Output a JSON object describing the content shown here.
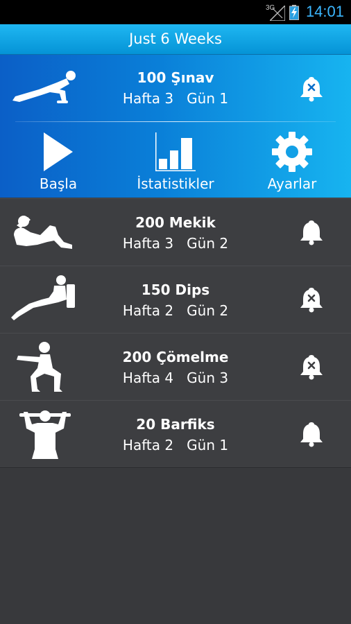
{
  "status_bar": {
    "network": "3G",
    "time": "14:01",
    "icons": [
      "signal-icon",
      "battery-charging-icon"
    ]
  },
  "header": {
    "title": "Just 6 Weeks"
  },
  "featured": {
    "name": "100 Şınav",
    "subtitle": "Hafta 3   Gün 1",
    "icon": "pushup-figure-icon",
    "reminder_icon": "bell-off-icon",
    "actions": [
      {
        "label": "Başla",
        "icon": "play-icon"
      },
      {
        "label": "İstatistikler",
        "icon": "bar-chart-icon"
      },
      {
        "label": "Ayarlar",
        "icon": "gear-icon"
      }
    ]
  },
  "exercises": [
    {
      "name": "200 Mekik",
      "subtitle": "Hafta 3   Gün 2",
      "icon": "situp-figure-icon",
      "reminder_icon": "bell-icon"
    },
    {
      "name": "150 Dips",
      "subtitle": "Hafta 2   Gün 2",
      "icon": "dips-figure-icon",
      "reminder_icon": "bell-off-icon"
    },
    {
      "name": "200 Çömelme",
      "subtitle": "Hafta 4   Gün 3",
      "icon": "squat-figure-icon",
      "reminder_icon": "bell-off-icon"
    },
    {
      "name": "20 Barfiks",
      "subtitle": "Hafta 2   Gün 1",
      "icon": "pullup-figure-icon",
      "reminder_icon": "bell-icon"
    }
  ],
  "colors": {
    "accent": "#1fb7f2",
    "panel_dark": "#0b5fc7",
    "list_bg": "#3d3e41",
    "clock": "#3cb7ff"
  }
}
